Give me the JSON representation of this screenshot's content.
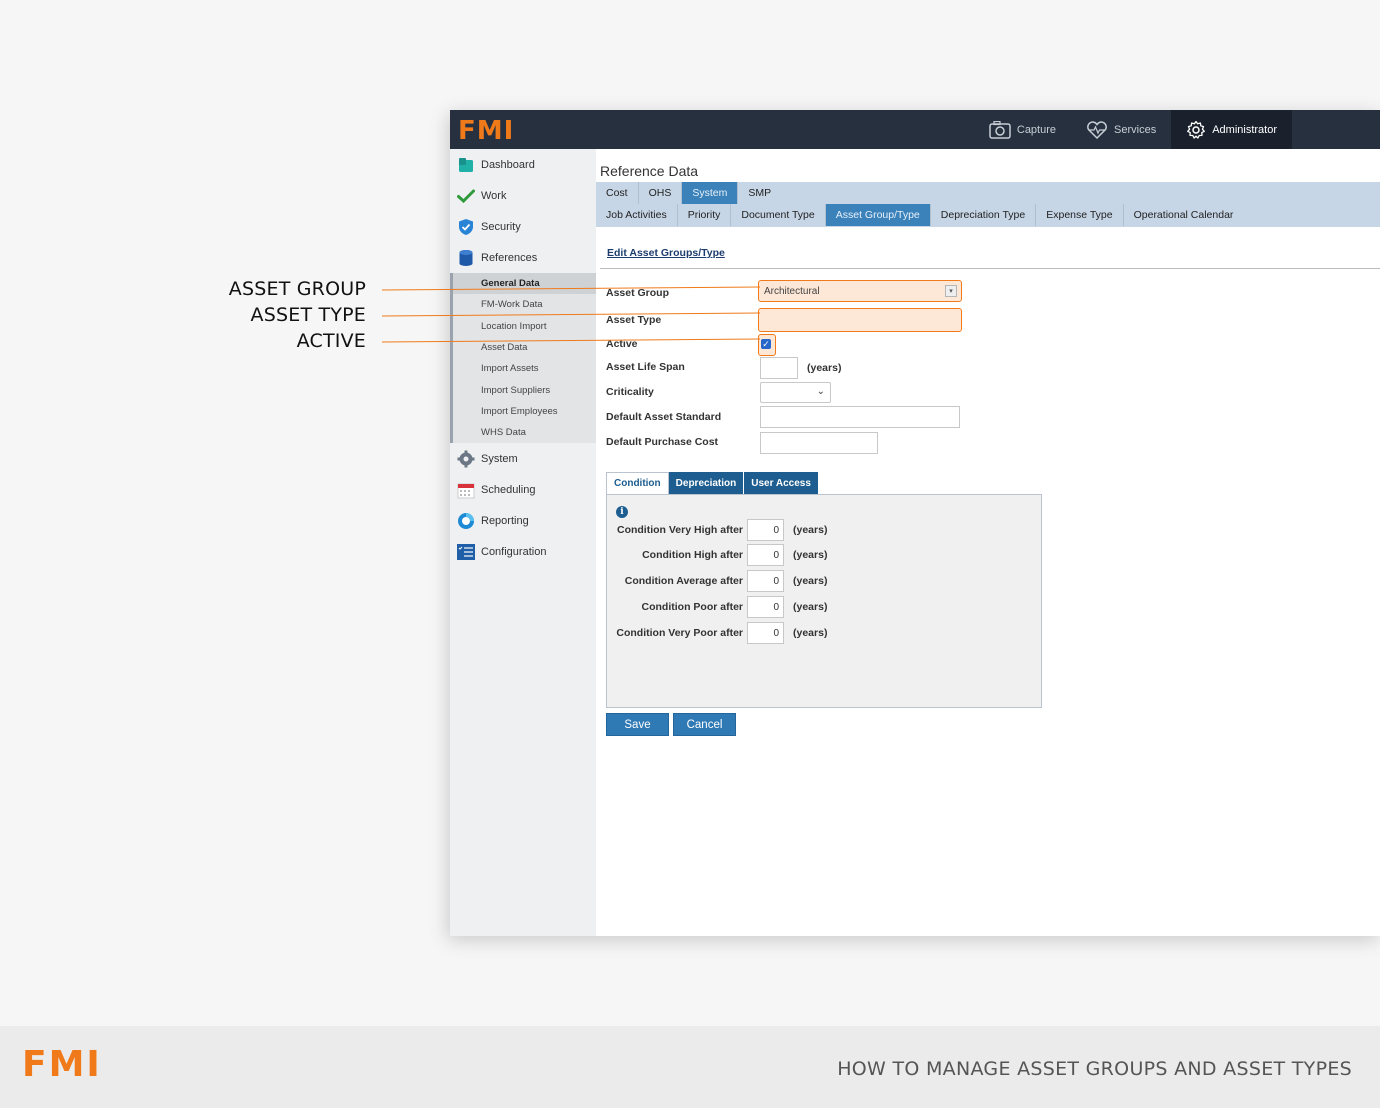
{
  "callouts": [
    "ASSET GROUP",
    "ASSET TYPE",
    "ACTIVE"
  ],
  "app": {
    "logo": "FMI",
    "topnav": [
      {
        "label": "Capture",
        "icon": "camera-icon"
      },
      {
        "label": "Services",
        "icon": "heartbeat-icon"
      },
      {
        "label": "Administrator",
        "icon": "gear-icon"
      }
    ]
  },
  "sidebar": {
    "items": [
      {
        "label": "Dashboard",
        "icon": "dashboard-icon"
      },
      {
        "label": "Work",
        "icon": "checkmark-icon"
      },
      {
        "label": "Security",
        "icon": "shield-icon"
      },
      {
        "label": "References",
        "icon": "database-icon"
      }
    ],
    "references_sub": [
      "General Data",
      "FM-Work Data",
      "Location Import",
      "Asset Data",
      "Import Assets",
      "Import Suppliers",
      "Import Employees",
      "WHS Data"
    ],
    "items_after": [
      {
        "label": "System",
        "icon": "gear-icon"
      },
      {
        "label": "Scheduling",
        "icon": "calendar-icon"
      },
      {
        "label": "Reporting",
        "icon": "chart-icon"
      },
      {
        "label": "Configuration",
        "icon": "list-icon"
      }
    ]
  },
  "main": {
    "title": "Reference Data",
    "tabs_row1": [
      "Cost",
      "OHS",
      "System",
      "SMP"
    ],
    "tabs_row2": [
      "Job Activities",
      "Priority",
      "Document Type",
      "Asset Group/Type",
      "Depreciation Type",
      "Expense Type",
      "Operational Calendar"
    ],
    "section_link": "Edit Asset Groups/Type",
    "form": {
      "asset_group_label": "Asset Group",
      "asset_group_value": "Architectural",
      "asset_type_label": "Asset Type",
      "active_label": "Active",
      "life_span_label": "Asset Life Span",
      "years_unit": "(years)",
      "criticality_label": "Criticality",
      "default_standard_label": "Default Asset Standard",
      "default_cost_label": "Default Purchase Cost"
    },
    "inner_tabs": [
      "Condition",
      "Depreciation",
      "User Access"
    ],
    "conditions": [
      {
        "label": "Condition Very High after",
        "value": "0",
        "unit": "(years)"
      },
      {
        "label": "Condition High after",
        "value": "0",
        "unit": "(years)"
      },
      {
        "label": "Condition Average after",
        "value": "0",
        "unit": "(years)"
      },
      {
        "label": "Condition Poor after",
        "value": "0",
        "unit": "(years)"
      },
      {
        "label": "Condition Very Poor after",
        "value": "0",
        "unit": "(years)"
      }
    ],
    "save_label": "Save",
    "cancel_label": "Cancel",
    "checkmark": "✓",
    "info": "i"
  },
  "footer": {
    "logo": "FMI",
    "title": "HOW TO MANAGE ASSET GROUPS AND ASSET TYPES"
  },
  "colors": {
    "accent": "#f07a1a",
    "topbar": "#26303f",
    "tab_active": "#3b82bb",
    "button": "#2f79b5"
  }
}
